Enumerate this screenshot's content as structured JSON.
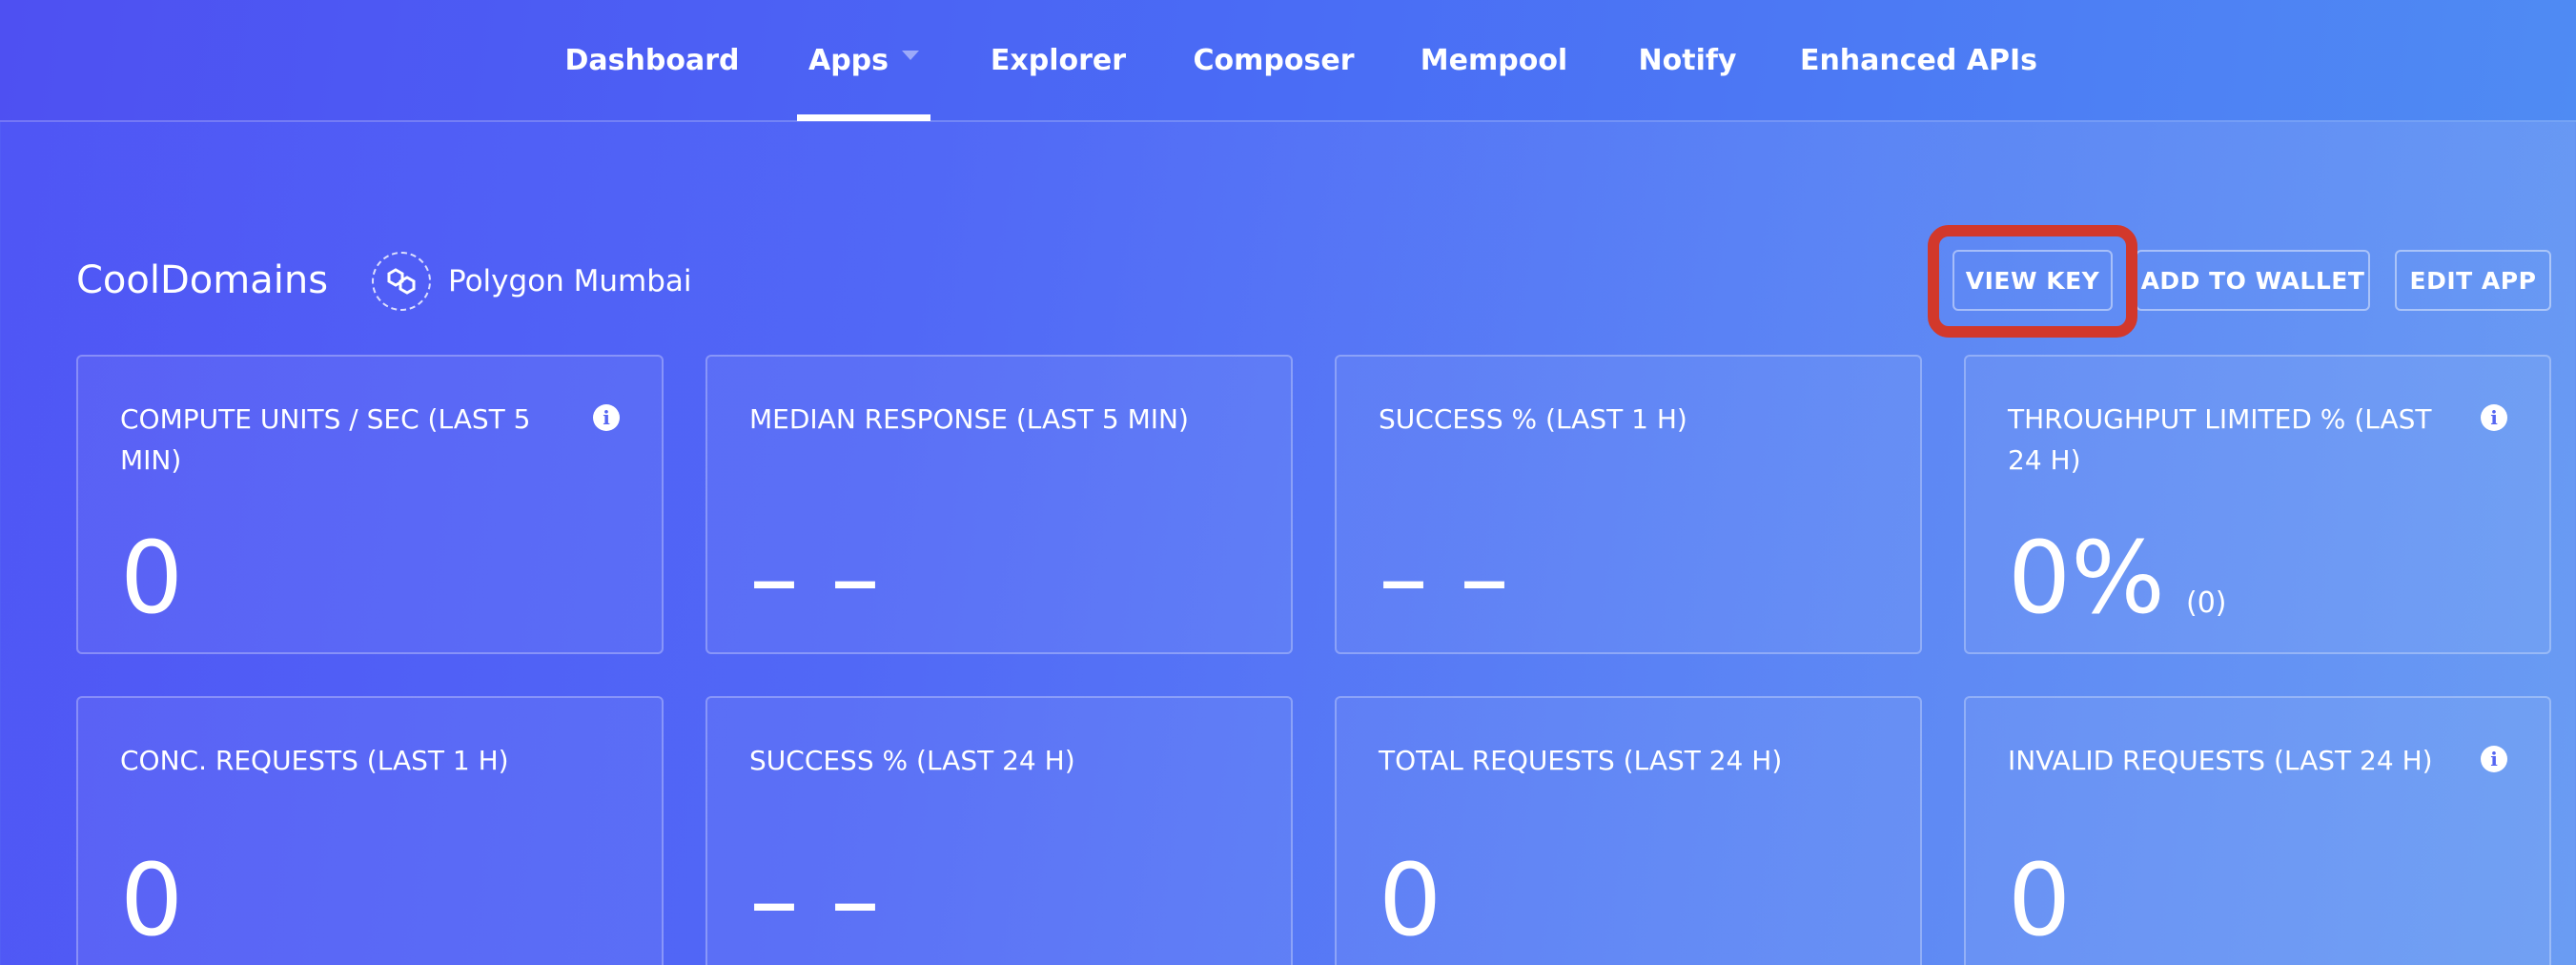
{
  "nav": {
    "items": [
      {
        "label": "Dashboard"
      },
      {
        "label": "Apps"
      },
      {
        "label": "Explorer"
      },
      {
        "label": "Composer"
      },
      {
        "label": "Mempool"
      },
      {
        "label": "Notify"
      },
      {
        "label": "Enhanced APIs"
      }
    ],
    "active": "Apps"
  },
  "app": {
    "name": "CoolDomains",
    "network": "Polygon Mumbai",
    "network_icon": "polygon-logo-icon"
  },
  "actions": {
    "view_key": "VIEW KEY",
    "add_to_wallet": "ADD TO WALLET",
    "edit_app": "EDIT APP"
  },
  "highlight_color": "#d2382b",
  "metrics": [
    {
      "title": "COMPUTE UNITS / SEC (LAST 5 MIN)",
      "value": "0",
      "info": true
    },
    {
      "title": "MEDIAN RESPONSE (LAST 5 MIN)",
      "value": "– –",
      "info": false
    },
    {
      "title": "SUCCESS % (LAST 1 H)",
      "value": "– –",
      "info": false
    },
    {
      "title": "THROUGHPUT LIMITED % (LAST 24 H)",
      "value": "0%",
      "sub": "(0)",
      "info": true
    },
    {
      "title": "CONC. REQUESTS (LAST 1 H)",
      "value": "0",
      "info": false
    },
    {
      "title": "SUCCESS % (LAST 24 H)",
      "value": "– –",
      "info": false
    },
    {
      "title": "TOTAL REQUESTS (LAST 24 H)",
      "value": "0",
      "info": false
    },
    {
      "title": "INVALID REQUESTS (LAST 24 H)",
      "value": "0",
      "info": true
    }
  ]
}
